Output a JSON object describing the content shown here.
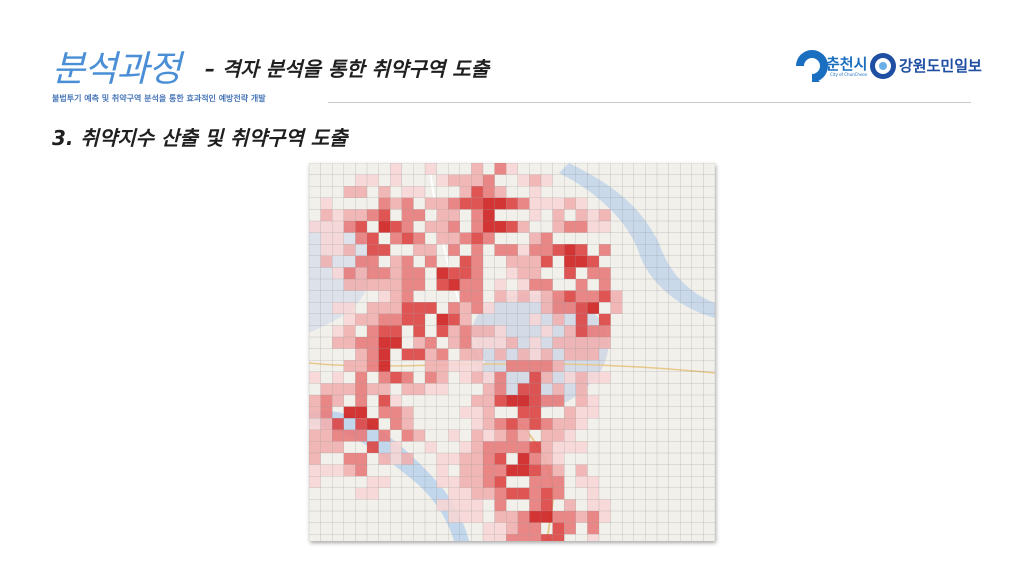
{
  "header": {
    "title_main": "분석과정",
    "title_sub": "– 격자 분석을 통한 취약구역 도출",
    "subtitle": "불법투기 예측 및 취약구역 분석을 통한 효과적인 예방전략 개발"
  },
  "logos": {
    "chuncheon_name": "춘천시",
    "chuncheon_en": "City of ChunCheon",
    "newspaper_name": "강원도민일보",
    "chuncheon_color": "#1b6fc1",
    "newspaper_color": "#1f4fa3"
  },
  "section": {
    "title": "3. 취약지수 산출 및 취약구역 도출"
  },
  "map": {
    "grid_color": "#8a8a8a",
    "heat_colors": [
      "#f6d6d6",
      "#f0b0b0",
      "#e87b7b",
      "#dd4444",
      "#cf2020"
    ],
    "urban_color": "#d4dbe6",
    "river_color": "#b8d2ea"
  }
}
